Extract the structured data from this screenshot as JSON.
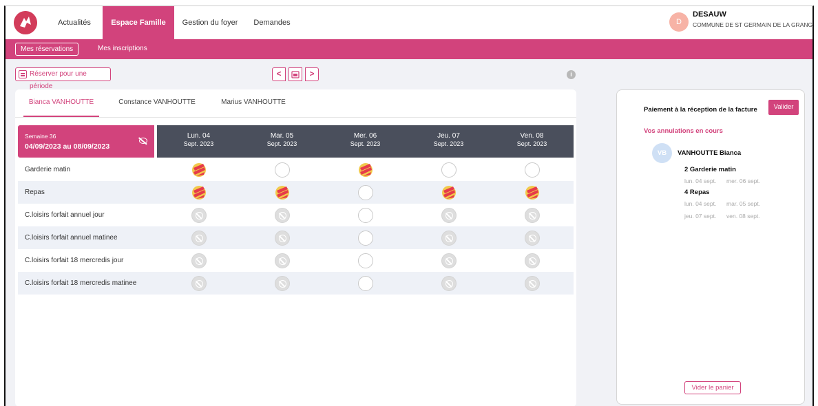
{
  "nav": {
    "items": [
      {
        "label": "Actualités",
        "active": false
      },
      {
        "label": "Espace Famille",
        "active": true
      },
      {
        "label": "Gestion du foyer",
        "active": false
      },
      {
        "label": "Demandes",
        "active": false
      }
    ]
  },
  "user": {
    "initial": "D",
    "name": "DESAUW",
    "commune": "COMMUNE DE ST GERMAIN DE LA GRANGE"
  },
  "subnav": {
    "items": [
      {
        "label": "Mes réservations",
        "active": true
      },
      {
        "label": "Mes inscriptions",
        "active": false
      }
    ]
  },
  "toolbar": {
    "period_label": "Réserver pour une période",
    "prev": "<",
    "next": ">"
  },
  "children_tabs": [
    {
      "label": "Bianca VANHOUTTE",
      "active": true
    },
    {
      "label": "Constance VANHOUTTE",
      "active": false
    },
    {
      "label": "Marius VANHOUTTE",
      "active": false
    }
  ],
  "week": {
    "label": "Semaine 36",
    "range": "04/09/2023 au 08/09/2023"
  },
  "days": [
    {
      "name": "Lun. 04",
      "month": "Sept. 2023"
    },
    {
      "name": "Mar. 05",
      "month": "Sept. 2023"
    },
    {
      "name": "Mer. 06",
      "month": "Sept. 2023"
    },
    {
      "name": "Jeu. 07",
      "month": "Sept. 2023"
    },
    {
      "name": "Ven. 08",
      "month": "Sept. 2023"
    }
  ],
  "activities": [
    {
      "label": "Garderie matin",
      "cells": [
        "booked",
        "empty",
        "booked",
        "empty",
        "empty"
      ]
    },
    {
      "label": "Repas",
      "cells": [
        "booked",
        "booked",
        "empty",
        "booked",
        "booked"
      ]
    },
    {
      "label": "C.loisirs forfait annuel jour",
      "cells": [
        "disabled",
        "disabled",
        "empty",
        "disabled",
        "disabled"
      ]
    },
    {
      "label": "C.loisirs forfait annuel matinee",
      "cells": [
        "disabled",
        "disabled",
        "empty",
        "disabled",
        "disabled"
      ]
    },
    {
      "label": "C.loisirs forfait 18 mercredis jour",
      "cells": [
        "disabled",
        "disabled",
        "empty",
        "disabled",
        "disabled"
      ]
    },
    {
      "label": "C.loisirs forfait 18 mercredis matinee",
      "cells": [
        "disabled",
        "disabled",
        "empty",
        "disabled",
        "disabled"
      ]
    }
  ],
  "side": {
    "payment_title": "Paiement à la réception de la facture",
    "valider_label": "Valider",
    "cancellations_title": "Vos annulations en cours",
    "child_initials": "VB",
    "child_name": "VANHOUTTE Bianca",
    "groups": [
      {
        "title": "2 Garderie matin",
        "dates": [
          "lun. 04 sept.",
          "mer. 06 sept."
        ]
      },
      {
        "title": "4 Repas",
        "dates": [
          "lun. 04 sept.",
          "mar. 05 sept.",
          "jeu. 07 sept.",
          "ven. 08 sept."
        ]
      }
    ],
    "clear_label": "Vider le panier"
  }
}
